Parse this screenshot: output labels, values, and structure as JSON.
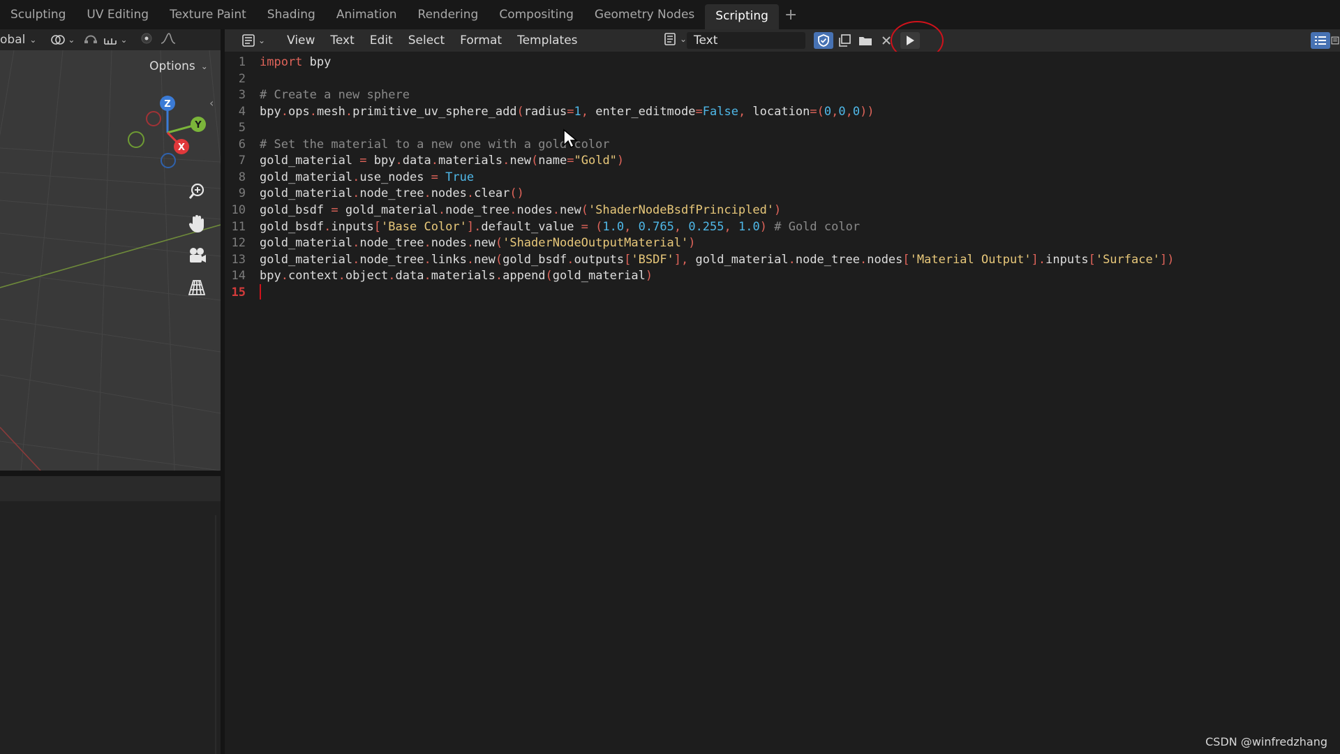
{
  "workspace_tabs": [
    "Sculpting",
    "UV Editing",
    "Texture Paint",
    "Shading",
    "Animation",
    "Rendering",
    "Compositing",
    "Geometry Nodes",
    "Scripting"
  ],
  "active_tab": "Scripting",
  "add_tab_label": "+",
  "viewport": {
    "transform_orientation": "obal",
    "options_label": "Options",
    "gizmo_labels": {
      "z": "Z",
      "y": "Y",
      "x": "X"
    }
  },
  "editor": {
    "menu": [
      "View",
      "Text",
      "Edit",
      "Select",
      "Format",
      "Templates"
    ],
    "text_name": "Text",
    "lines": [
      {
        "num": "1",
        "code": "import bpy"
      },
      {
        "num": "2",
        "code": ""
      },
      {
        "num": "3",
        "code": "# Create a new sphere"
      },
      {
        "num": "4",
        "code": "bpy.ops.mesh.primitive_uv_sphere_add(radius=1, enter_editmode=False, location=(0,0,0))"
      },
      {
        "num": "5",
        "code": ""
      },
      {
        "num": "6",
        "code": "# Set the material to a new one with a gold color"
      },
      {
        "num": "7",
        "code": "gold_material = bpy.data.materials.new(name=\"Gold\")"
      },
      {
        "num": "8",
        "code": "gold_material.use_nodes = True"
      },
      {
        "num": "9",
        "code": "gold_material.node_tree.nodes.clear()"
      },
      {
        "num": "10",
        "code": "gold_bsdf = gold_material.node_tree.nodes.new('ShaderNodeBsdfPrincipled')"
      },
      {
        "num": "11",
        "code": "gold_bsdf.inputs['Base Color'].default_value = (1.0, 0.765, 0.255, 1.0) # Gold color"
      },
      {
        "num": "12",
        "code": "gold_material.node_tree.nodes.new('ShaderNodeOutputMaterial')"
      },
      {
        "num": "13",
        "code": "gold_material.node_tree.links.new(gold_bsdf.outputs['BSDF'], gold_material.node_tree.nodes['Material Output'].inputs['Surface'])"
      },
      {
        "num": "14",
        "code": "bpy.context.object.data.materials.append(gold_material)"
      },
      {
        "num": "15",
        "code": ""
      }
    ],
    "current_line": "15"
  },
  "watermark": "CSDN @winfredzhang",
  "colors": {
    "keyword": "#e0645a",
    "comment": "#8a8a8a",
    "string": "#e8c87a",
    "number": "#4fb8e8",
    "punct": "#e0645a",
    "highlight": "#d0121b",
    "gizmo_x": "#e0383b",
    "gizmo_y": "#7bb53a",
    "gizmo_z": "#3b7bd6"
  }
}
